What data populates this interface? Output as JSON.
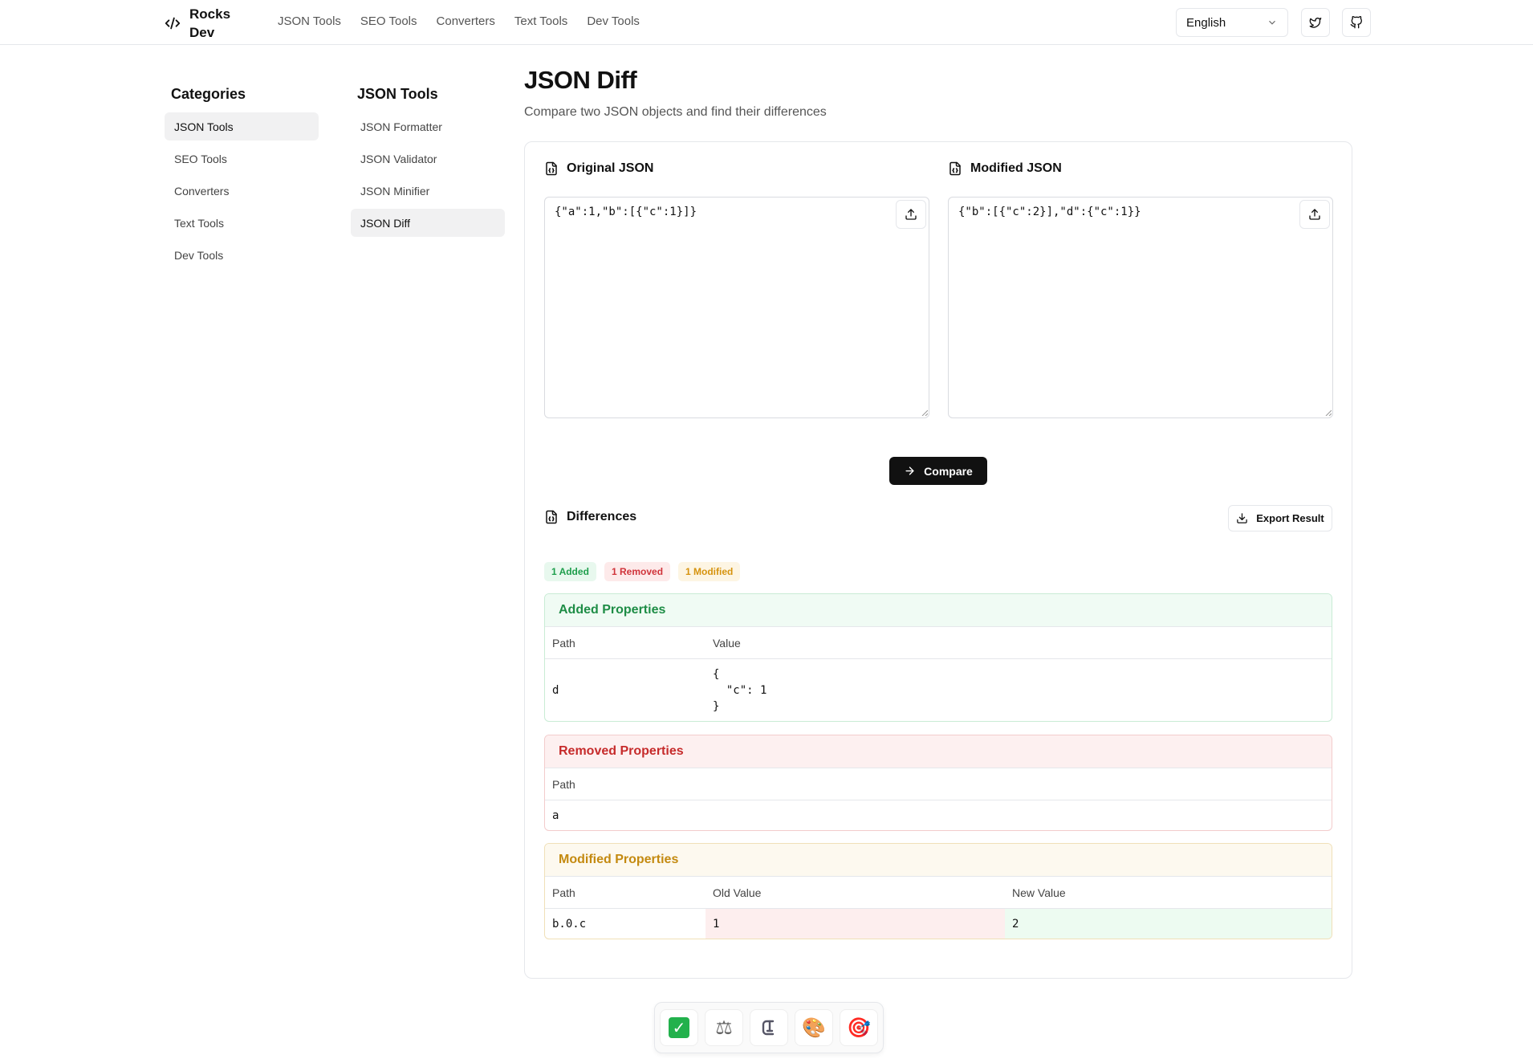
{
  "header": {
    "logo_text": "Rocks Dev",
    "nav": [
      "JSON Tools",
      "SEO Tools",
      "Converters",
      "Text Tools",
      "Dev Tools"
    ],
    "language": "English"
  },
  "categories": {
    "title": "Categories",
    "items": [
      "JSON Tools",
      "SEO Tools",
      "Converters",
      "Text Tools",
      "Dev Tools"
    ],
    "active": "JSON Tools"
  },
  "tools": {
    "title": "JSON Tools",
    "items": [
      "JSON Formatter",
      "JSON Validator",
      "JSON Minifier",
      "JSON Diff"
    ],
    "active": "JSON Diff"
  },
  "main": {
    "title": "JSON Diff",
    "subtitle": "Compare two JSON objects and find their differences",
    "original_label": "Original JSON",
    "original_value": "{\"a\":1,\"b\":[{\"c\":1}]}",
    "modified_label": "Modified JSON",
    "modified_value": "{\"b\":[{\"c\":2}],\"d\":{\"c\":1}}",
    "compare_label": "Compare",
    "differences_label": "Differences",
    "export_label": "Export Result",
    "badges": {
      "added": "1 Added",
      "removed": "1 Removed",
      "modified": "1 Modified"
    }
  },
  "added": {
    "title": "Added Properties",
    "headers": [
      "Path",
      "Value"
    ],
    "rows": [
      {
        "path": "d",
        "value": "{\n  \"c\": 1\n}"
      }
    ]
  },
  "removed": {
    "title": "Removed Properties",
    "headers": [
      "Path"
    ],
    "rows": [
      {
        "path": "a"
      }
    ]
  },
  "modified": {
    "title": "Modified Properties",
    "headers": [
      "Path",
      "Old Value",
      "New Value"
    ],
    "rows": [
      {
        "path": "b.0.c",
        "old": "1",
        "new": "2"
      }
    ]
  },
  "dock": {
    "items": [
      "check-mark-icon",
      "balance-scale-icon",
      "clamp-icon",
      "palette-icon",
      "target-icon"
    ]
  },
  "colors": {
    "added": "#1e8d46",
    "removed": "#c62b2b",
    "modified": "#c48a10",
    "primary": "#111111"
  }
}
